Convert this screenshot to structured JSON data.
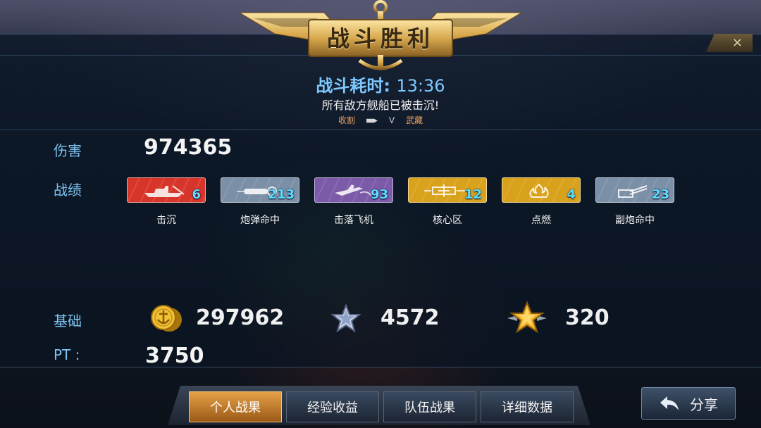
{
  "header": {
    "title": "战斗胜利",
    "close_label": "×",
    "battle_time_label": "战斗耗时:",
    "battle_time_value": "13:36",
    "result_message": "所有敌方舰船已被击沉!",
    "kill_feed": {
      "killer": "收割",
      "victim_marker": "V",
      "victim": "武藏"
    }
  },
  "damage": {
    "label": "伤害",
    "value": "974365"
  },
  "record": {
    "label": "战绩",
    "stats": [
      {
        "name": "击沉",
        "count": "6",
        "icon": "sunk-ship-icon",
        "color": "#d8352a"
      },
      {
        "name": "炮弹命中",
        "count": "213",
        "icon": "shell-hit-icon",
        "color": "#7b8fa6"
      },
      {
        "name": "击落飞机",
        "count": "93",
        "icon": "plane-shot-down-icon",
        "color": "#7b5aa8"
      },
      {
        "name": "核心区",
        "count": "12",
        "icon": "citadel-icon",
        "color": "#d9a21c"
      },
      {
        "name": "点燃",
        "count": "4",
        "icon": "fire-icon",
        "color": "#d9a21c"
      },
      {
        "name": "副炮命中",
        "count": "23",
        "icon": "secondary-gun-icon",
        "color": "#7b8fa6"
      }
    ]
  },
  "base": {
    "label": "基础",
    "coins": {
      "icon": "gold-coin-icon",
      "value": "297962"
    },
    "silver_exp": {
      "icon": "silver-star-icon",
      "value": "4572"
    },
    "gold_exp": {
      "icon": "gold-star-icon",
      "value": "320"
    }
  },
  "pt": {
    "label": "PT :",
    "value": "3750"
  },
  "tabs": [
    {
      "label": "个人战果",
      "active": true
    },
    {
      "label": "经验收益",
      "active": false
    },
    {
      "label": "队伍战果",
      "active": false
    },
    {
      "label": "详细数据",
      "active": false
    }
  ],
  "share": {
    "label": "分享",
    "icon": "back-arrow-icon"
  },
  "colors": {
    "accent_blue": "#7fc4f2",
    "time_blue": "#7cc8ff",
    "tab_active": "#e6a046",
    "count_cyan": "#5ce0ff"
  }
}
